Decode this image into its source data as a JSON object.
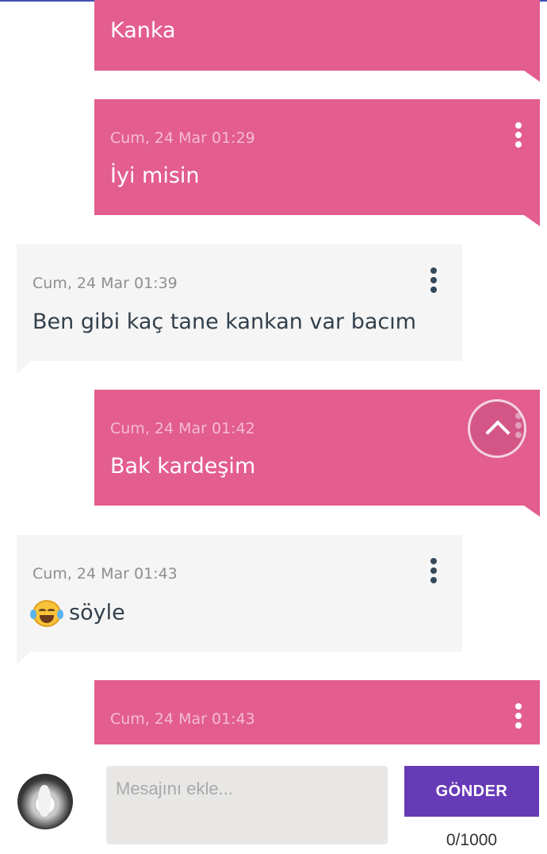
{
  "messages": [
    {
      "direction": "outgoing",
      "timestamp": "",
      "text": "Kanka"
    },
    {
      "direction": "outgoing",
      "timestamp": "Cum, 24 Mar 01:29",
      "text": "İyi misin"
    },
    {
      "direction": "incoming",
      "timestamp": "Cum, 24 Mar 01:39",
      "text": "Ben gibi kaç tane kankan var bacım"
    },
    {
      "direction": "outgoing",
      "timestamp": "Cum, 24 Mar 01:42",
      "text": "Bak kardeşim"
    },
    {
      "direction": "incoming",
      "timestamp": "Cum, 24 Mar 01:43",
      "text": "söyle",
      "emoji": "face-with-tears-of-joy"
    },
    {
      "direction": "outgoing",
      "timestamp": "Cum, 24 Mar 01:43",
      "text": ""
    }
  ],
  "composer": {
    "placeholder": "Mesajını ekle...",
    "send_label": "GÖNDER",
    "char_counter": "0/1000"
  },
  "icons": {
    "message_menu": "more-vertical-icon",
    "scroll_top": "chevron-up-icon",
    "avatar": "user-avatar"
  },
  "colors": {
    "outgoing_bubble": "#e35d8f",
    "incoming_bubble": "#f5f5f5",
    "send_button": "#673ab7",
    "input_background": "#e8e7e5"
  }
}
